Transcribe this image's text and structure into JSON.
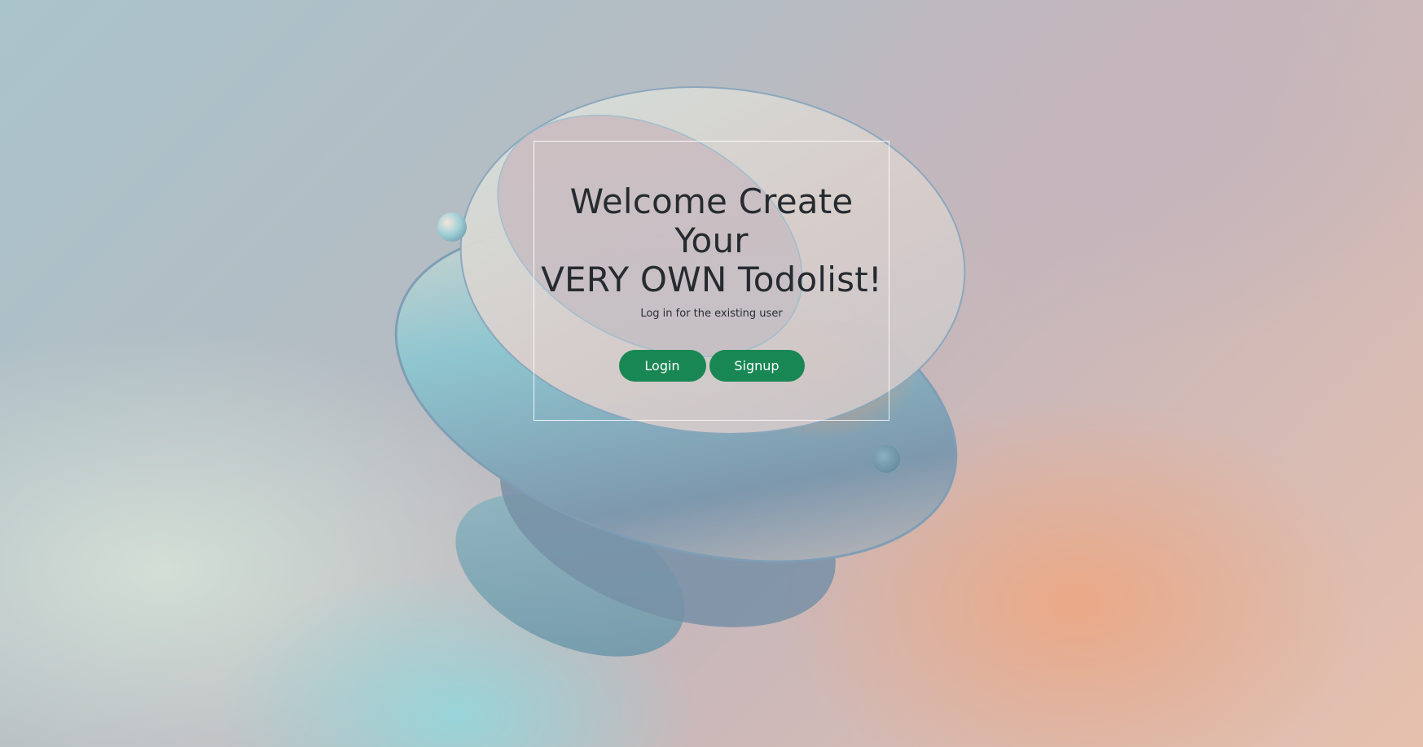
{
  "welcome": {
    "title_line1": "Welcome Create Your",
    "title_line2": "VERY OWN Todolist!",
    "subtitle": "Log in for the existing user"
  },
  "actions": {
    "login_label": "Login",
    "signup_label": "Signup"
  },
  "colors": {
    "button": "#198754",
    "title_text": "#262b30"
  }
}
